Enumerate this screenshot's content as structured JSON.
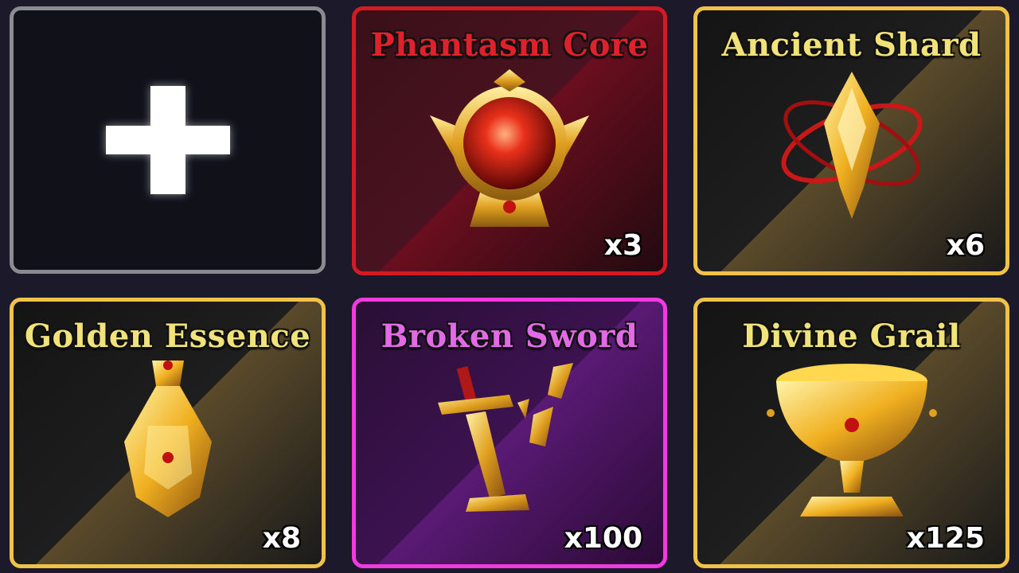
{
  "add_slot": {
    "icon": "plus-icon"
  },
  "items": [
    {
      "name": "Phantasm Core",
      "quantity": "x3",
      "title_color": "#e0202a",
      "border_color": "#d41a22",
      "icon": "red-orb-icon"
    },
    {
      "name": "Ancient Shard",
      "quantity": "x6",
      "title_color": "#f2e27a",
      "border_color": "#f1c24a",
      "icon": "golden-shard-icon"
    },
    {
      "name": "Golden Essence",
      "quantity": "x8",
      "title_color": "#f2e27a",
      "border_color": "#f1c24a",
      "icon": "golden-flask-icon"
    },
    {
      "name": "Broken Sword",
      "quantity": "x100",
      "title_color": "#e26ae6",
      "border_color": "#f13ae0",
      "icon": "broken-sword-icon"
    },
    {
      "name": "Divine Grail",
      "quantity": "x125",
      "title_color": "#f2e27a",
      "border_color": "#f1c24a",
      "icon": "grail-icon"
    }
  ]
}
